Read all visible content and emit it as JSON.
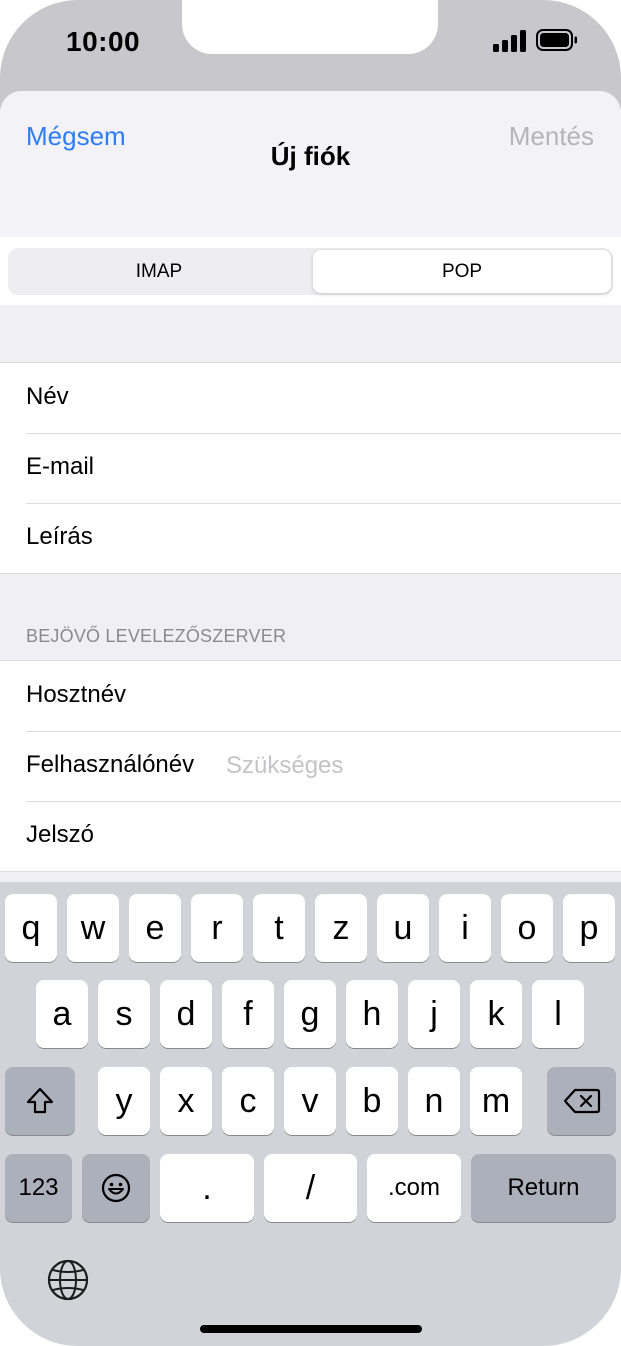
{
  "status_bar": {
    "time": "10:00"
  },
  "nav": {
    "cancel": "Mégsem",
    "title": "Új fiók",
    "save": "Mentés"
  },
  "segment": {
    "options": [
      "IMAP",
      "POP"
    ],
    "selected": "POP"
  },
  "account_fields": [
    {
      "label": "Név",
      "value": "",
      "placeholder": ""
    },
    {
      "label": "E-mail",
      "value": "",
      "placeholder": ""
    },
    {
      "label": "Leírás",
      "value": "",
      "placeholder": ""
    }
  ],
  "incoming": {
    "header": "BEJÖVŐ LEVELEZŐSZERVER",
    "fields": [
      {
        "label": "Hosztnév",
        "value": "",
        "placeholder": ""
      },
      {
        "label": "Felhasználónév",
        "value": "",
        "placeholder": "Szükséges"
      },
      {
        "label": "Jelszó",
        "value": "",
        "placeholder": ""
      }
    ]
  },
  "keyboard": {
    "row1": [
      "q",
      "w",
      "e",
      "r",
      "t",
      "z",
      "u",
      "i",
      "o",
      "p"
    ],
    "row2": [
      "a",
      "s",
      "d",
      "f",
      "g",
      "h",
      "j",
      "k",
      "l"
    ],
    "row3": [
      "y",
      "x",
      "c",
      "v",
      "b",
      "n",
      "m"
    ],
    "bottom": {
      "numbers": "123",
      "dot": ".",
      "slash": "/",
      "dotcom": ".com",
      "return": "Return"
    },
    "icons": {
      "shift": "shift-icon",
      "delete": "backspace-icon",
      "emoji": "emoji-icon",
      "globe": "globe-icon"
    }
  },
  "colors": {
    "accent": "#2f7df6",
    "disabled": "#b4b4b9",
    "placeholder": "#c4c4c6",
    "keyboard_bg": "#d1d3d9"
  }
}
